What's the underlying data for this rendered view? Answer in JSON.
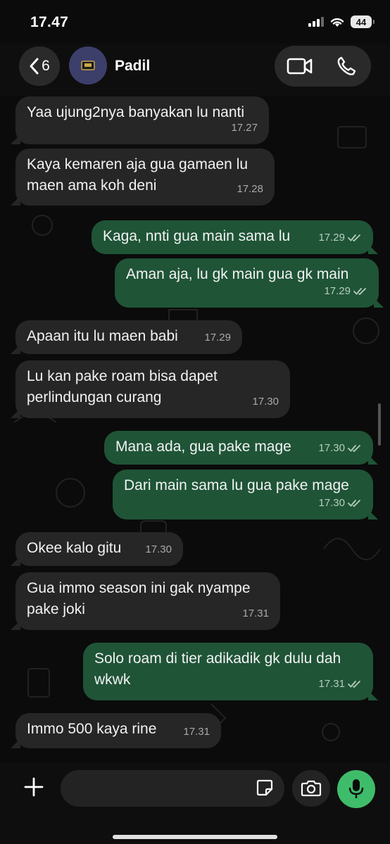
{
  "status_bar": {
    "time": "17.47",
    "battery": "44"
  },
  "header": {
    "back_count": "6",
    "contact_name": "Padil"
  },
  "messages": [
    {
      "dir": "in",
      "lines": [
        "Yaa ujung2nya banyakan lu nanti"
      ],
      "time": "17.27"
    },
    {
      "dir": "in",
      "lines": [
        "Kaya kemaren aja gua gamaen lu",
        "maen ama koh deni"
      ],
      "time": "17.28"
    },
    {
      "dir": "out",
      "lines": [
        "Kaga, nnti gua main sama lu"
      ],
      "time": "17.29"
    },
    {
      "dir": "out",
      "lines": [
        "Aman aja, lu gk main gua gk main"
      ],
      "time": "17.29"
    },
    {
      "dir": "in",
      "lines": [
        "Apaan itu lu maen babi"
      ],
      "time": "17.29"
    },
    {
      "dir": "in",
      "lines": [
        "Lu kan pake roam bisa dapet",
        "perlindungan curang"
      ],
      "time": "17.30"
    },
    {
      "dir": "out",
      "lines": [
        "Mana ada, gua pake mage"
      ],
      "time": "17.30"
    },
    {
      "dir": "out",
      "lines": [
        "Dari main sama lu gua pake mage"
      ],
      "time": "17.30"
    },
    {
      "dir": "in",
      "lines": [
        "Okee kalo gitu"
      ],
      "time": "17.30"
    },
    {
      "dir": "in",
      "lines": [
        "Gua immo season ini gak nyampe",
        "pake joki"
      ],
      "time": "17.31"
    },
    {
      "dir": "out",
      "lines": [
        "Solo roam di tier adikadik gk dulu dah",
        "wkwk"
      ],
      "time": "17.31"
    },
    {
      "dir": "in",
      "lines": [
        "Immo 500 kaya rine"
      ],
      "time": "17.31"
    }
  ],
  "icons": {
    "back": "chevron-left-icon",
    "video": "video-call-icon",
    "phone": "phone-icon",
    "plus": "plus-icon",
    "sticker": "sticker-icon",
    "camera": "camera-icon",
    "mic": "microphone-icon",
    "read": "double-check-icon"
  },
  "colors": {
    "incoming_bubble": "#262626",
    "outgoing_bubble": "#1f5437",
    "mic_button": "#3fbc6a"
  }
}
